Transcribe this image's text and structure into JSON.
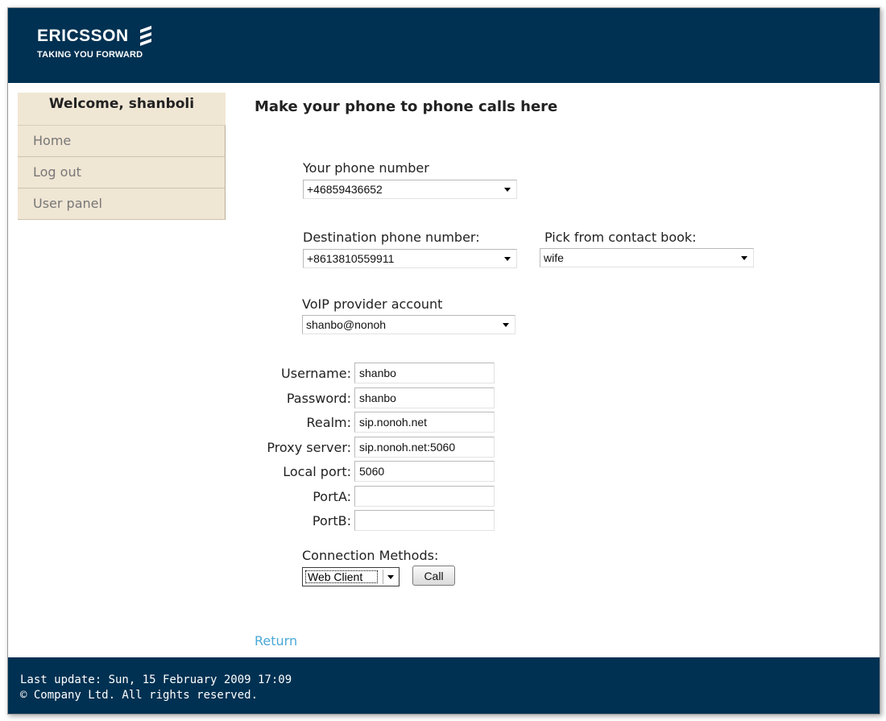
{
  "header": {
    "brand_name": "ERICSSON",
    "tagline": "TAKING YOU FORWARD",
    "logo_icon": "ericsson-stripes-icon",
    "background_color": "#003152"
  },
  "sidebar": {
    "welcome": "Welcome, shanboli",
    "items": [
      {
        "label": "Home"
      },
      {
        "label": "Log out"
      },
      {
        "label": "User panel"
      }
    ],
    "background_color": "#f0e6d4"
  },
  "main": {
    "title": "Make your phone to phone calls here",
    "your_phone": {
      "label": "Your phone number",
      "value": "+46859436652"
    },
    "destination": {
      "label": "Destination phone number:",
      "value": "+8613810559911"
    },
    "contact_book": {
      "label": "Pick from contact book:",
      "value": "wife"
    },
    "voip": {
      "label": "VoIP provider account",
      "value": "shanbo@nonoh"
    },
    "fields": {
      "username": {
        "label": "Username:",
        "value": "shanbo"
      },
      "password": {
        "label": "Password:",
        "value": "shanbo"
      },
      "realm": {
        "label": "Realm:",
        "value": "sip.nonoh.net"
      },
      "proxy": {
        "label": "Proxy server:",
        "value": "sip.nonoh.net:5060"
      },
      "local_port": {
        "label": "Local port:",
        "value": "5060"
      },
      "porta": {
        "label": "PortA:",
        "value": ""
      },
      "portb": {
        "label": "PortB:",
        "value": ""
      }
    },
    "connection": {
      "label": "Connection Methods:",
      "value": "Web Client"
    },
    "call_button": "Call",
    "return_link": "Return",
    "link_color": "#4aa8d8"
  },
  "footer": {
    "last_update": "Last update: Sun, 15 February 2009 17:09",
    "copyright": "© Company Ltd. All rights reserved."
  }
}
